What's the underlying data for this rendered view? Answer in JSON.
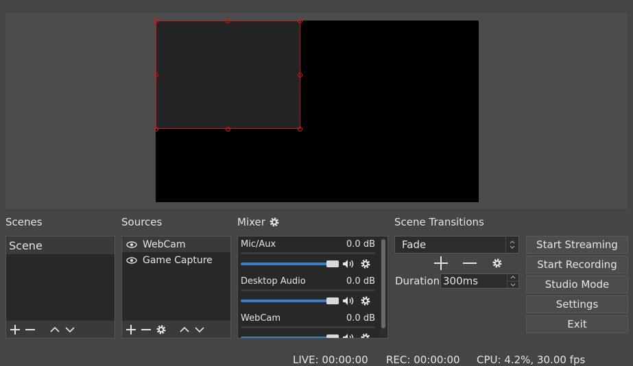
{
  "scenes": {
    "title": "Scenes",
    "items": [
      {
        "label": "Scene",
        "selected": true
      }
    ]
  },
  "sources": {
    "title": "Sources",
    "items": [
      {
        "label": "WebCam",
        "visible": true,
        "selected": true
      },
      {
        "label": "Game Capture",
        "visible": true,
        "selected": false
      }
    ]
  },
  "mixer": {
    "title": "Mixer",
    "channels": [
      {
        "name": "Mic/Aux",
        "db": "0.0 dB",
        "level": 1.0
      },
      {
        "name": "Desktop Audio",
        "db": "0.0 dB",
        "level": 1.0
      },
      {
        "name": "WebCam",
        "db": "0.0 dB",
        "level": 1.0
      }
    ]
  },
  "transitions": {
    "title": "Scene Transitions",
    "selected": "Fade",
    "duration_label": "Duration",
    "duration_value": "300ms"
  },
  "controls": {
    "start_streaming": "Start Streaming",
    "start_recording": "Start Recording",
    "studio_mode": "Studio Mode",
    "settings": "Settings",
    "exit": "Exit"
  },
  "status": {
    "live": "LIVE: 00:00:00",
    "rec": "REC: 00:00:00",
    "cpu": "CPU: 4.2%, 30.00 fps"
  },
  "colors": {
    "accent": "#3a7ecb",
    "selection_border": "#c81a1a",
    "background": "#454545"
  },
  "icons": [
    "eye-icon",
    "plus-icon",
    "minus-icon",
    "gear-icon",
    "chevron-up-icon",
    "chevron-down-icon",
    "speaker-icon"
  ]
}
